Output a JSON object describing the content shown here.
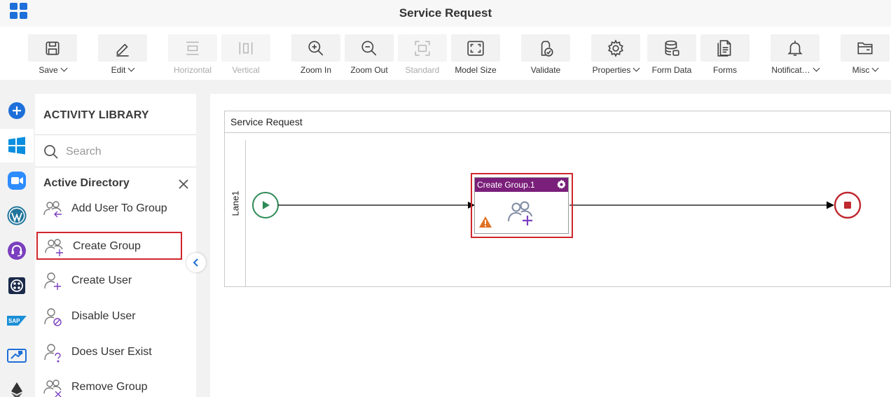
{
  "app": {
    "title": "Service Request"
  },
  "toolbar": {
    "save": "Save",
    "edit": "Edit",
    "horizontal": "Horizontal",
    "vertical": "Vertical",
    "zoom_in": "Zoom In",
    "zoom_out": "Zoom Out",
    "standard": "Standard",
    "model_size": "Model Size",
    "validate": "Validate",
    "properties": "Properties",
    "form_data": "Form Data",
    "forms": "Forms",
    "notifications": "Notificat…",
    "misc": "Misc"
  },
  "rail": {
    "items": [
      "add-icon",
      "windows-icon",
      "zoom-icon",
      "wordpress-icon",
      "headset-icon",
      "twilio-icon",
      "sap-icon",
      "power-automate-icon",
      "ethereum-icon"
    ]
  },
  "library": {
    "title": "ACTIVITY LIBRARY",
    "search_placeholder": "Search",
    "category": "Active Directory",
    "items": [
      {
        "label": "Add User To Group",
        "icon": "add-user-to-group-icon"
      },
      {
        "label": "Create Group",
        "icon": "create-group-icon"
      },
      {
        "label": "Create User",
        "icon": "create-user-icon"
      },
      {
        "label": "Disable User",
        "icon": "disable-user-icon"
      },
      {
        "label": "Does User Exist",
        "icon": "does-user-exist-icon"
      },
      {
        "label": "Remove Group",
        "icon": "remove-group-icon"
      }
    ],
    "selected_item": "Create Group"
  },
  "canvas": {
    "pool_title": "Service Request",
    "lane_label": "Lane1",
    "task": {
      "title": "Create Group.1",
      "warning": true
    },
    "colors": {
      "start": "#2e8b57",
      "end": "#c0282f",
      "task_header": "#7a1f7a",
      "selection": "#d0262d"
    }
  }
}
